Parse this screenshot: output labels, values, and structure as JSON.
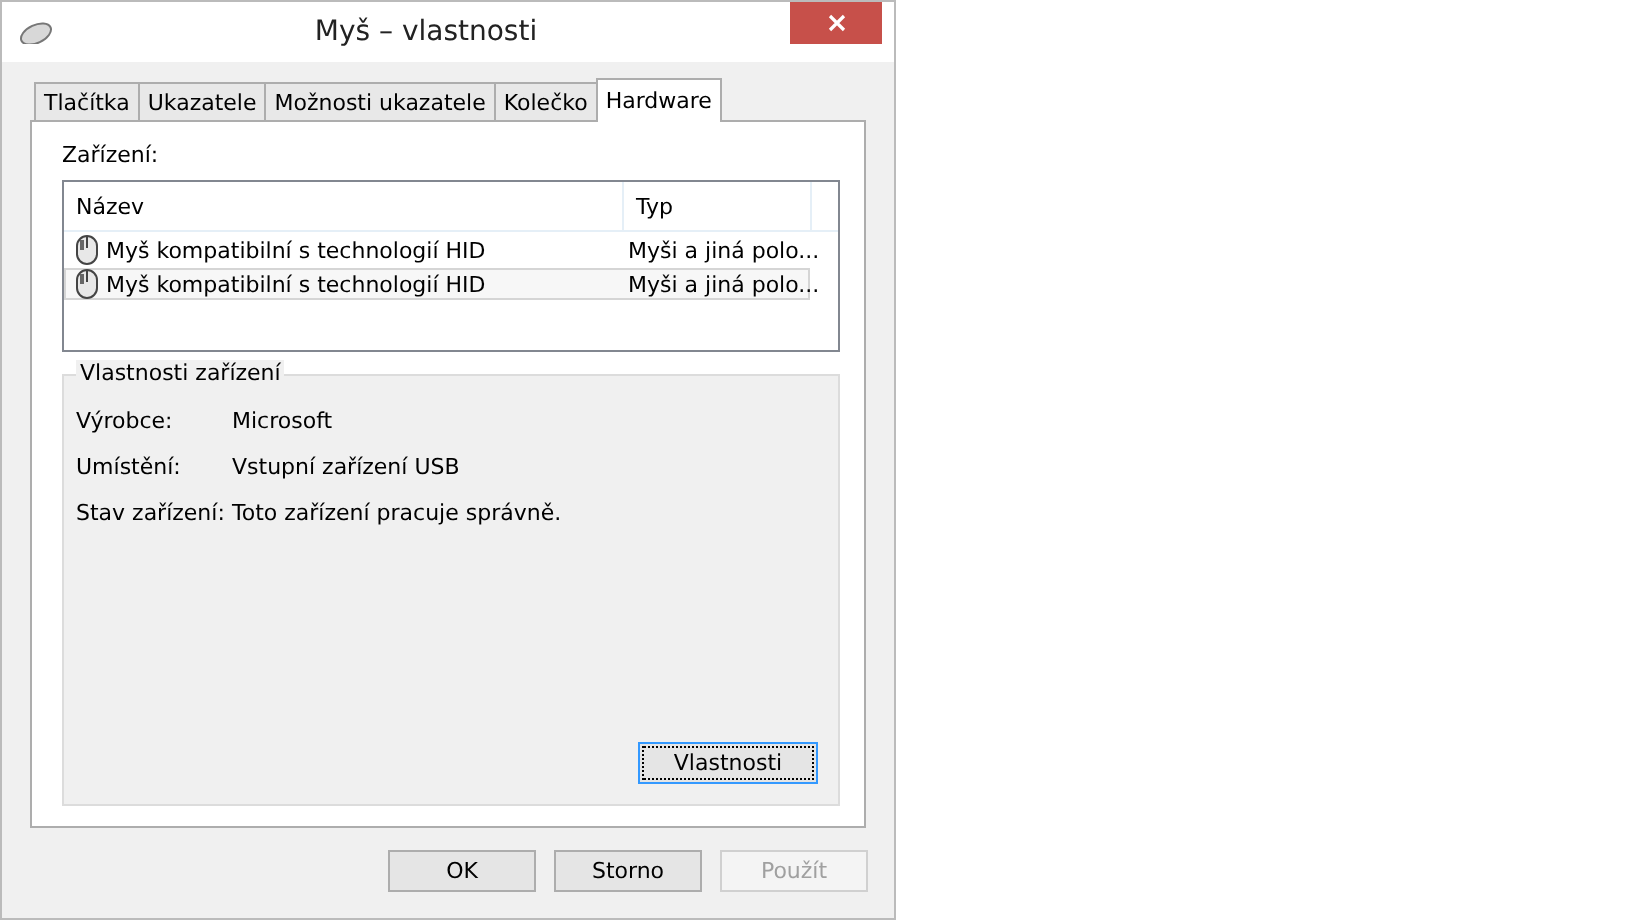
{
  "window": {
    "title": "Myš – vlastnosti"
  },
  "tabs": [
    {
      "label": "Tlačítka",
      "selected": false
    },
    {
      "label": "Ukazatele",
      "selected": false
    },
    {
      "label": "Možnosti ukazatele",
      "selected": false
    },
    {
      "label": "Kolečko",
      "selected": false
    },
    {
      "label": "Hardware",
      "selected": true
    }
  ],
  "devices": {
    "label": "Zařízení:",
    "columns": [
      "Název",
      "Typ"
    ],
    "rows": [
      {
        "name": "Myš kompatibilní s technologií HID",
        "type": "Myši a jiná polo...",
        "selected": false
      },
      {
        "name": "Myš kompatibilní s technologií HID",
        "type": "Myši a jiná polo...",
        "selected": true
      }
    ]
  },
  "properties": {
    "title": "Vlastnosti zařízení",
    "items": [
      {
        "label": "Výrobce:",
        "value": "Microsoft"
      },
      {
        "label": "Umístění:",
        "value": "Vstupní zařízení USB"
      },
      {
        "label": "Stav zařízení:",
        "value": "Toto zařízení pracuje správně."
      }
    ],
    "button": "Vlastnosti"
  },
  "buttons": [
    {
      "label": "OK",
      "disabled": false
    },
    {
      "label": "Storno",
      "disabled": false
    },
    {
      "label": "Použít",
      "disabled": true
    }
  ]
}
